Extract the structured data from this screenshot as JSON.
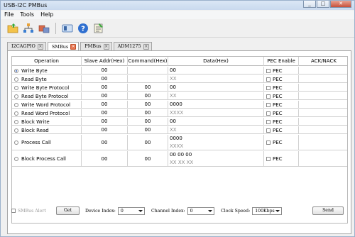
{
  "window": {
    "title": "USB-I2C PMBus",
    "controls": [
      "_",
      "□",
      "✕"
    ]
  },
  "menu": [
    "File",
    "Tools",
    "Help"
  ],
  "toolbar": {
    "icons": [
      "open-folder-icon",
      "network-icon",
      "devices-icon",
      "card-icon",
      "help-icon",
      "settings-icon"
    ]
  },
  "tabs": [
    {
      "label": "I2CAGPIO",
      "active": false
    },
    {
      "label": "SMBus",
      "active": true
    },
    {
      "label": "PMBus",
      "active": false
    },
    {
      "label": "ADM1275",
      "active": false
    }
  ],
  "table": {
    "headers": [
      "Operation",
      "Slave Addr(Hex)",
      "Command(Hex)",
      "Data(Hex)",
      "PEC Enable",
      "ACK/NACK"
    ],
    "pec_label": "PEC",
    "rows": [
      {
        "op": "Write Byte",
        "selected": true,
        "addr": "00",
        "cmd": "",
        "data": [
          "00"
        ],
        "data_gray": [
          false
        ],
        "ack": ""
      },
      {
        "op": "Read Byte",
        "selected": false,
        "addr": "00",
        "cmd": "",
        "data": [
          "XX"
        ],
        "data_gray": [
          true
        ],
        "ack": ""
      },
      {
        "op": "Write Byte Protocol",
        "selected": false,
        "addr": "00",
        "cmd": "00",
        "data": [
          "00"
        ],
        "data_gray": [
          false
        ],
        "ack": ""
      },
      {
        "op": "Read Byte Protocol",
        "selected": false,
        "addr": "00",
        "cmd": "00",
        "data": [
          "XX"
        ],
        "data_gray": [
          true
        ],
        "ack": ""
      },
      {
        "op": "Write Word Protocol",
        "selected": false,
        "addr": "00",
        "cmd": "00",
        "data": [
          "0000"
        ],
        "data_gray": [
          false
        ],
        "ack": ""
      },
      {
        "op": "Read Word Protocol",
        "selected": false,
        "addr": "00",
        "cmd": "00",
        "data": [
          "XXXX"
        ],
        "data_gray": [
          true
        ],
        "ack": ""
      },
      {
        "op": "Block Write",
        "selected": false,
        "addr": "00",
        "cmd": "00",
        "data": [
          "00"
        ],
        "data_gray": [
          false
        ],
        "ack": ""
      },
      {
        "op": "Block Read",
        "selected": false,
        "addr": "00",
        "cmd": "00",
        "data": [
          "XX"
        ],
        "data_gray": [
          true
        ],
        "ack": ""
      },
      {
        "op": "Process Call",
        "selected": false,
        "addr": "00",
        "cmd": "00",
        "data": [
          "0000",
          "XXXX"
        ],
        "data_gray": [
          false,
          true
        ],
        "ack": ""
      },
      {
        "op": "Block Process Call",
        "selected": false,
        "addr": "00",
        "cmd": "00",
        "data": [
          "00 00 00",
          "XX XX XX"
        ],
        "data_gray": [
          false,
          true
        ],
        "ack": ""
      }
    ]
  },
  "bottom": {
    "smbus_alert_label": "SMBus Alert",
    "get_label": "Get",
    "device_index_label": "Device Index:",
    "device_index_value": "0",
    "channel_index_label": "Channel Index:",
    "channel_index_value": "0",
    "clock_speed_label": "Clock Speed:",
    "clock_speed_value": "100Kbps",
    "send_label": "Send"
  }
}
